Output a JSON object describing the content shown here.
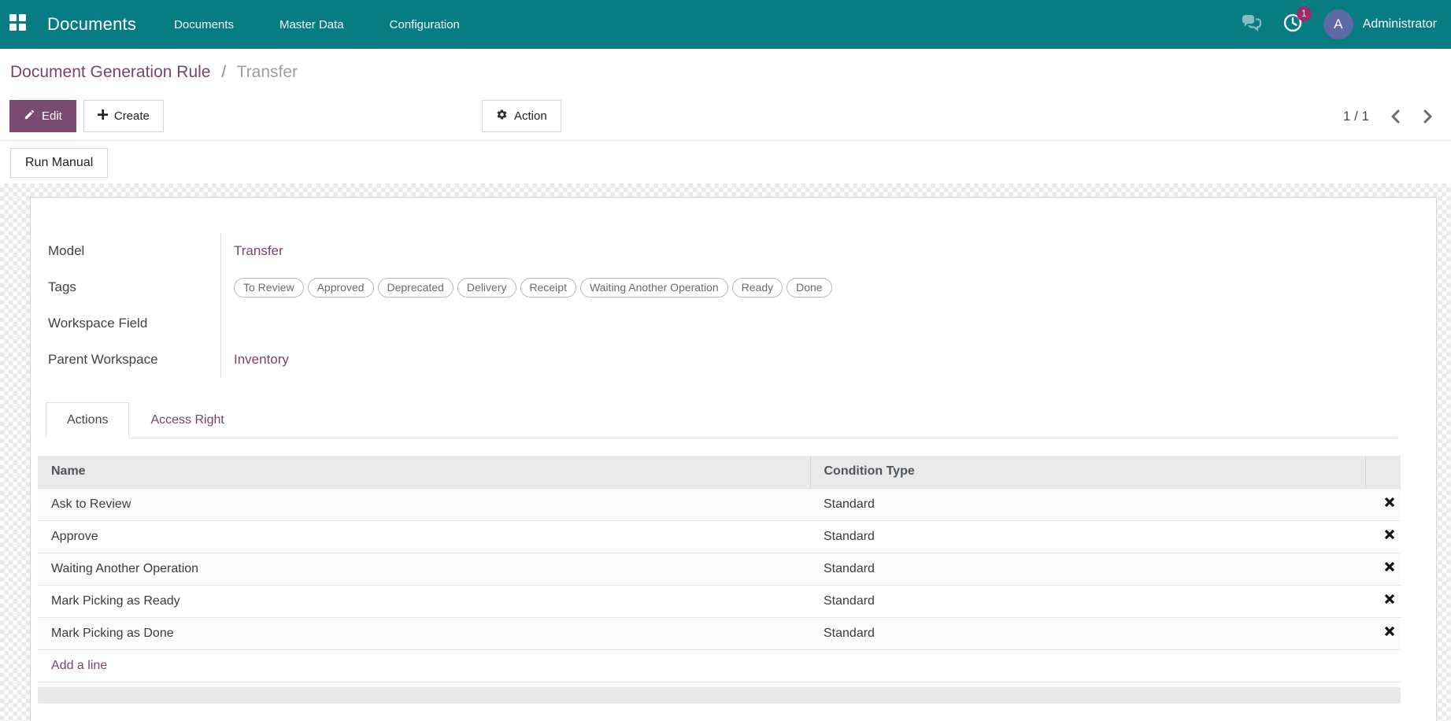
{
  "navbar": {
    "app_name": "Documents",
    "menu": [
      "Documents",
      "Master Data",
      "Configuration"
    ],
    "activity_count": "1",
    "user_initial": "A",
    "user_name": "Administrator"
  },
  "breadcrumb": {
    "parent": "Document Generation Rule",
    "separator": "/",
    "current": "Transfer"
  },
  "control_panel": {
    "edit": "Edit",
    "create": "Create",
    "action": "Action",
    "pager": "1 / 1",
    "run_manual": "Run Manual"
  },
  "form": {
    "model": {
      "label": "Model",
      "value": "Transfer"
    },
    "tags": {
      "label": "Tags",
      "items": [
        "To Review",
        "Approved",
        "Deprecated",
        "Delivery",
        "Receipt",
        "Waiting Another Operation",
        "Ready",
        "Done"
      ]
    },
    "workspace_field": {
      "label": "Workspace Field",
      "value": ""
    },
    "parent_workspace": {
      "label": "Parent Workspace",
      "value": "Inventory"
    }
  },
  "tabs": {
    "actions": "Actions",
    "access_right": "Access Right"
  },
  "table": {
    "headers": {
      "name": "Name",
      "condition_type": "Condition Type"
    },
    "rows": [
      {
        "name": "Ask to Review",
        "condition_type": "Standard"
      },
      {
        "name": "Approve",
        "condition_type": "Standard"
      },
      {
        "name": "Waiting Another Operation",
        "condition_type": "Standard"
      },
      {
        "name": "Mark Picking as Ready",
        "condition_type": "Standard"
      },
      {
        "name": "Mark Picking as Done",
        "condition_type": "Standard"
      }
    ],
    "add_line": "Add a line"
  },
  "colors": {
    "navbar_bg": "#077c82",
    "primary_button": "#7b4a70",
    "link_purple": "#7a4468",
    "activity_badge": "#a02b63",
    "avatar_bg": "#5c6aa5",
    "table_header_bg": "#eaeaea"
  }
}
